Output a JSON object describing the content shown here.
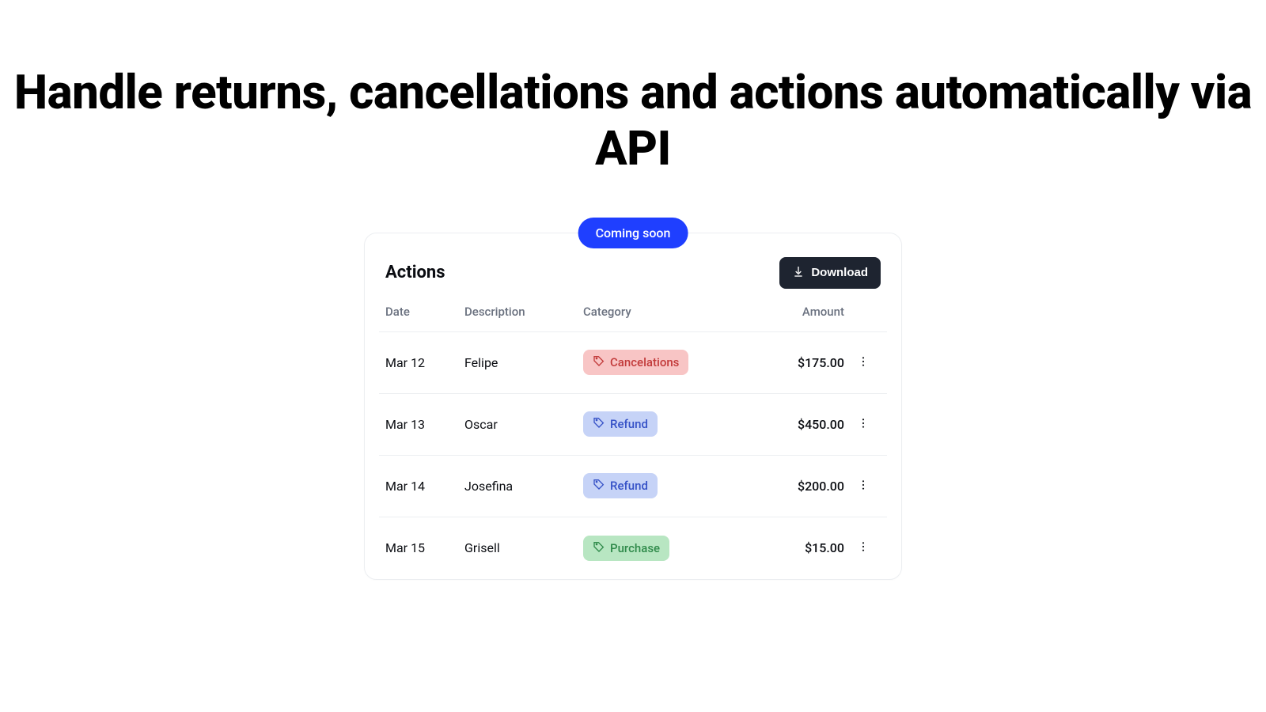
{
  "headline": "Handle returns, cancellations and actions automatically via API",
  "badge": "Coming soon",
  "card": {
    "title": "Actions",
    "download_label": "Download",
    "columns": {
      "date": "Date",
      "description": "Description",
      "category": "Category",
      "amount": "Amount"
    },
    "rows": [
      {
        "date": "Mar 12",
        "description": "Felipe",
        "category": "Cancelations",
        "category_kind": "red",
        "amount": "$175.00"
      },
      {
        "date": "Mar 13",
        "description": "Oscar",
        "category": "Refund",
        "category_kind": "blue",
        "amount": "$450.00"
      },
      {
        "date": "Mar 14",
        "description": "Josefina",
        "category": "Refund",
        "category_kind": "blue",
        "amount": "$200.00"
      },
      {
        "date": "Mar 15",
        "description": "Grisell",
        "category": "Purchase",
        "category_kind": "green",
        "amount": "$15.00"
      }
    ]
  }
}
